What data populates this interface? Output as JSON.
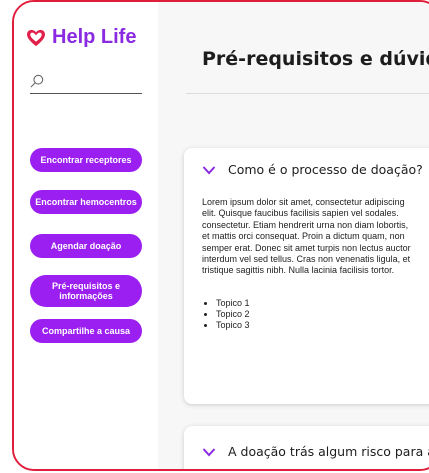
{
  "app": {
    "name": "Help Life",
    "brand_color": "#8a2be2",
    "heart_color": "#e0204a",
    "button_color": "#9b1ff0"
  },
  "search": {
    "placeholder": "",
    "icon": "search-icon"
  },
  "nav": {
    "items": [
      {
        "label": "Encontrar receptores"
      },
      {
        "label": "Encontrar hemocentros"
      },
      {
        "label": "Agendar doação"
      },
      {
        "label": "Pré-requisitos e informações"
      },
      {
        "label": "Compartilhe a causa"
      }
    ]
  },
  "page": {
    "title": "Pré-requisitos e dúvidas"
  },
  "faq": [
    {
      "question": "Como é o processo de doação?",
      "expanded": true,
      "lines": [
        "Lorem ipsum dolor sit amet, consectetur adipiscing",
        "elit.  Quisque  faucibus  facilisis  sapien  vel  sodales.",
        "consectetur. Etiam hendrerit urna non diam lobortis,",
        "et mattis orci consequat. Proin a dictum quam, non",
        "semper erat. Donec sit amet turpis non lectus auctor",
        "interdum vel sed tellus. Cras non venenatis ligula, et",
        "tristique sagittis nibh. Nulla lacinia facilisis tortor."
      ],
      "topics": [
        "Topico 1",
        "Topico 2",
        "Topico 3"
      ]
    },
    {
      "question": "A doação trás algum risco para a saúde?",
      "expanded": false
    }
  ]
}
